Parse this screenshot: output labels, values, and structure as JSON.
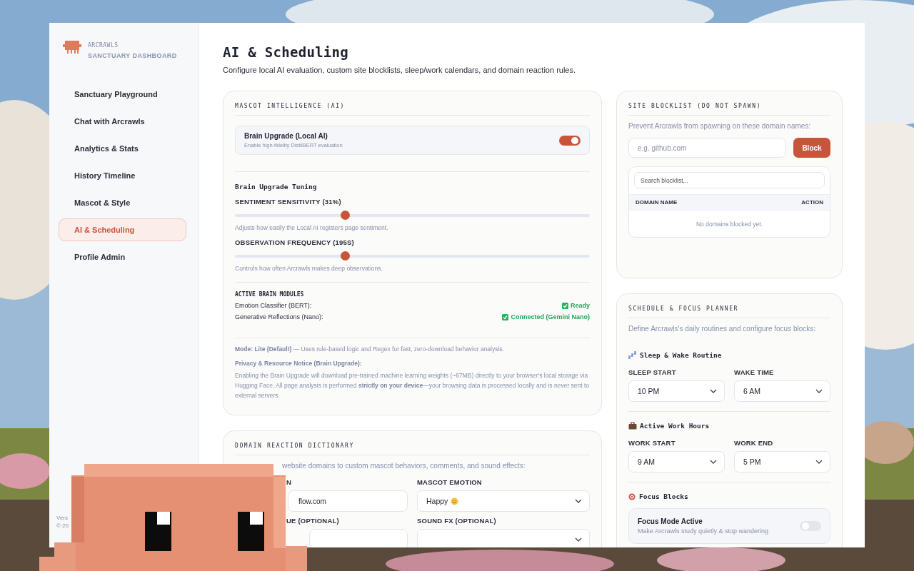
{
  "brand": {
    "name": "ARCRAWLS",
    "subtitle": "SANCTUARY DASHBOARD"
  },
  "sidebar": {
    "items": [
      {
        "label": "Sanctuary Playground",
        "selected": false
      },
      {
        "label": "Chat with Arcrawls",
        "selected": false
      },
      {
        "label": "Analytics & Stats",
        "selected": false
      },
      {
        "label": "History Timeline",
        "selected": false
      },
      {
        "label": "Mascot & Style",
        "selected": false
      },
      {
        "label": "AI & Scheduling",
        "selected": true
      },
      {
        "label": "Profile Admin",
        "selected": false
      }
    ],
    "footer": [
      "Vers",
      "© 20"
    ]
  },
  "page": {
    "title": "AI & Scheduling",
    "subtitle": "Configure local AI evaluation, custom site blocklists, sleep/work calendars, and domain reaction rules."
  },
  "ai_card": {
    "title": "MASCOT INTELLIGENCE (AI)",
    "toggle": {
      "label": "Brain Upgrade (Local AI)",
      "description": "Enable high-fidelity DistilBERT evaluation",
      "on": true
    },
    "tuning_heading": "Brain Upgrade Tuning",
    "sliders": [
      {
        "label": "SENTIMENT SENSITIVITY (31%)",
        "level": 0.31,
        "hint": "Adjusts how easily the Local AI registers page sentiment."
      },
      {
        "label": "OBSERVATION FREQUENCY (195S)",
        "level": 0.31,
        "hint": "Controls how often Arcrawls makes deep observations."
      }
    ],
    "modules_heading": "ACTIVE BRAIN MODULES",
    "modules": [
      {
        "name": "Emotion Classifier (BERT):",
        "status": "Ready",
        "ready": true
      },
      {
        "name": "Generative Reflections (Nano):",
        "status": "Connected (Gemini Nano)",
        "ready": true
      }
    ],
    "mode_note": "**Mode: Lite (Default)** — Uses rule-based logic and Regex for fast, zero-download behavior analysis.",
    "privacy_heading": "Privacy & Resource Notice (Brain Upgrade):",
    "privacy_text": "Enabling the Brain Upgrade will download pre-trained machine learning weights (~67MB) directly to your browser's local storage via Hugging Face. All page analysis is performed **strictly on your device**—your browsing data is processed locally and is never sent to external servers."
  },
  "domain_card": {
    "title": "DOMAIN REACTION DICTIONARY",
    "description": "website domains to custom mascot behaviors, comments, and sound effects:",
    "fields": [
      {
        "label": "N",
        "value": "flow.com",
        "kind": "text"
      },
      {
        "label": "MASCOT EMOTION",
        "value": "Happy",
        "kind": "select"
      },
      {
        "label": "UE (OPTIONAL)",
        "kind": "text"
      },
      {
        "label": "SOUND FX (OPTIONAL)",
        "kind": "select"
      }
    ]
  },
  "blocklist_card": {
    "title": "SITE BLOCKLIST (DO NOT SPAWN)",
    "description": "Prevent Arcrawls from spawning on these domain names:",
    "input_placeholder": "e.g. github.com",
    "button": "Block",
    "search_placeholder": "Search blocklist...",
    "columns": [
      "DOMAIN NAME",
      "ACTION"
    ],
    "empty": "No domains blocked yet."
  },
  "schedule_card": {
    "title": "SCHEDULE & FOCUS PLANNER",
    "description": "Define Arcrawls's daily routines and configure focus blocks:",
    "sections": [
      {
        "heading": "Sleep & Wake Routine",
        "kind": "sleep",
        "fields": [
          {
            "label": "SLEEP START",
            "value": "10 PM"
          },
          {
            "label": "WAKE TIME",
            "value": "6 AM"
          }
        ]
      },
      {
        "heading": "Active Work Hours",
        "kind": "work",
        "fields": [
          {
            "label": "WORK START",
            "value": "9 AM"
          },
          {
            "label": "WORK END",
            "value": "5 PM"
          }
        ]
      }
    ],
    "focus_heading": "Focus Blocks",
    "focus_toggle": {
      "label": "Focus Mode Active",
      "description": "Make Arcrawls study quietly & stop wandering",
      "on": false
    }
  }
}
